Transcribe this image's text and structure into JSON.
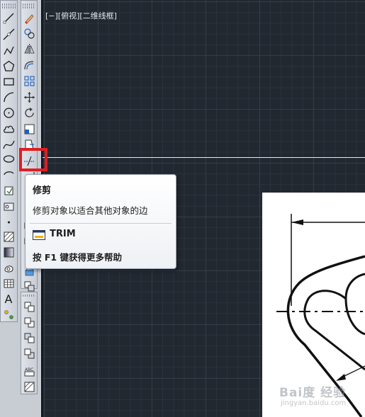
{
  "viewport": {
    "label": "[−][俯视][二维线框]"
  },
  "tooltip": {
    "title": "修剪",
    "description": "修剪对象以适合其他对象的边",
    "command": "TRIM",
    "help": "按 F1 键获得更多帮助"
  },
  "draw_toolbar": {
    "icons": [
      "line-icon",
      "construction-line-icon",
      "polyline-icon",
      "polygon-icon",
      "rectangle-icon",
      "arc-icon",
      "circle-icon",
      "revision-cloud-icon",
      "spline-icon",
      "ellipse-icon",
      "ellipse-arc-icon",
      "insert-block-icon",
      "make-block-icon",
      "point-icon",
      "hatch-icon",
      "gradient-icon",
      "region-icon",
      "table-icon",
      "multiline-text-icon",
      "add-selected-icon"
    ],
    "text_icon_glyph": "A"
  },
  "modify_toolbar": {
    "icons": [
      "erase-icon",
      "copy-icon",
      "mirror-icon",
      "offset-icon",
      "array-icon",
      "move-icon",
      "rotate-icon",
      "scale-icon",
      "stretch-icon",
      "trim-icon",
      "extend-icon",
      "break-icon",
      "join-icon",
      "chamfer-icon",
      "fillet-icon",
      "blend-icon",
      "explode-icon",
      "draw-order-front-icon",
      "draw-order-back-icon",
      "bring-above-icon",
      "send-under-icon",
      "text-to-front-icon",
      "hatch-to-back-icon"
    ]
  },
  "watermark": {
    "brand": "Bai度 经验",
    "url": "jingyan.baidu.com"
  },
  "colors": {
    "canvas": "#212830",
    "highlight": "#e01d22",
    "tooltip_bg": "#ffffff"
  }
}
